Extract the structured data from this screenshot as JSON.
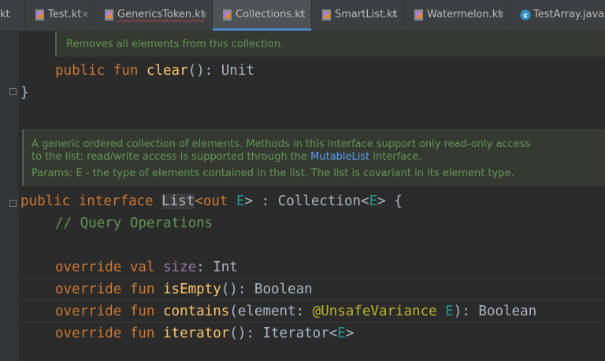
{
  "tabs": [
    {
      "label": "kt",
      "icon": "kotlin-file-icon"
    },
    {
      "label": "Test.kt",
      "icon": "kotlin-file-icon"
    },
    {
      "label": "GenericsToken.kt",
      "icon": "kotlin-file-icon"
    },
    {
      "label": "Collections.kt",
      "icon": "kotlin-file-icon"
    },
    {
      "label": "SmartList.kt",
      "icon": "kotlin-file-icon"
    },
    {
      "label": "Watermelon.kt",
      "icon": "kotlin-file-icon"
    },
    {
      "label": "TestArray.java",
      "icon": "java-class-icon"
    }
  ],
  "close_glyph": "×",
  "doc1": {
    "text": "Removes all elements from this collection."
  },
  "code1": {
    "kw1": "public",
    "kw2": "fun",
    "fn": "clear",
    "rest": "(): Unit"
  },
  "code2": {
    "brace": "}"
  },
  "doc2": {
    "text1": "A generic ordered collection of elements. Methods in this interface support only read-only access to the list; read/write access is supported through the ",
    "link": "MutableList",
    "text2": " interface.",
    "params_label": "Params:",
    "params_text": "E - the type of elements contained in the list. The list is covariant in its element type."
  },
  "code3": {
    "kw1": "public",
    "kw2": "interface",
    "name": "List",
    "lt": "<",
    "kw3": "out",
    "tp": "E",
    "mid": "> : Collection<",
    "tp2": "E",
    "end": "> {"
  },
  "code4": {
    "comment": "// Query Operations"
  },
  "code5": {
    "kw1": "override",
    "kw2": "val",
    "prop": "size",
    "rest": ": Int"
  },
  "code6": {
    "kw1": "override",
    "kw2": "fun",
    "fn": "isEmpty",
    "rest": "(): Boolean"
  },
  "code7": {
    "kw1": "override",
    "kw2": "fun",
    "fn": "contains",
    "p1": "(element: ",
    "ann": "@UnsafeVariance",
    "tp": "E",
    "rest": "): Boolean"
  },
  "code8": {
    "kw1": "override",
    "kw2": "fun",
    "fn": "iterator",
    "p1": "(): Iterator<",
    "tp": "E",
    "rest": ">"
  },
  "colors": {
    "keyword": "#cc7832",
    "function": "#ffc66d",
    "type_param": "#20999d",
    "property": "#9876aa",
    "comment": "#629755",
    "link": "#589df6"
  }
}
